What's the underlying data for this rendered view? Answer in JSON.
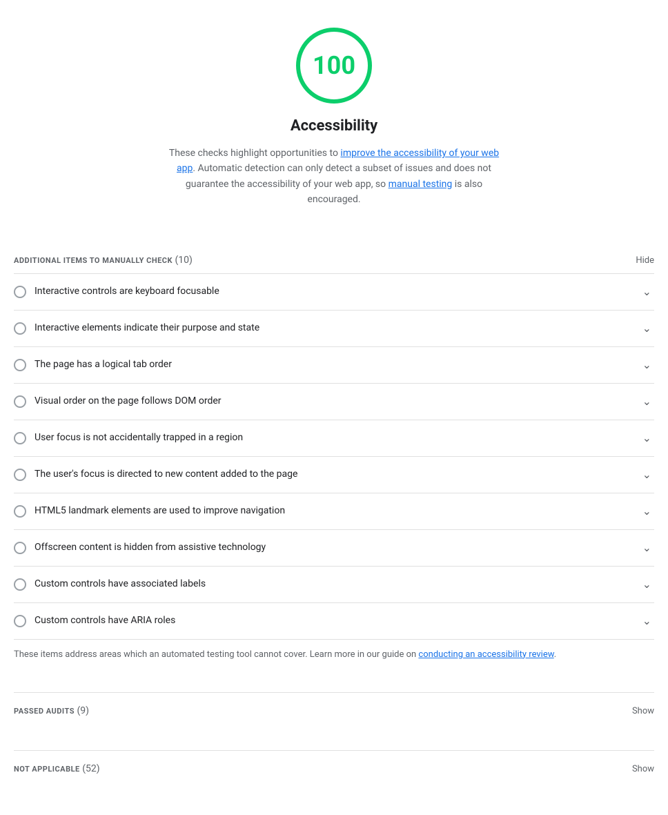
{
  "score": {
    "value": "100",
    "color": "#0cce6b",
    "title": "Accessibility"
  },
  "description": {
    "prefix": "These checks highlight opportunities to ",
    "link1_text": "improve the accessibility of your web app",
    "link1_href": "#",
    "middle": ". Automatic detection can only detect a subset of issues and does not guarantee the accessibility of your web app, so ",
    "link2_text": "manual testing",
    "link2_href": "#",
    "suffix": " is also encouraged."
  },
  "manual_section": {
    "title": "ADDITIONAL ITEMS TO MANUALLY CHECK",
    "count": "(10)",
    "toggle_label": "Hide"
  },
  "audit_items": [
    {
      "label": "Interactive controls are keyboard focusable"
    },
    {
      "label": "Interactive elements indicate their purpose and state"
    },
    {
      "label": "The page has a logical tab order"
    },
    {
      "label": "Visual order on the page follows DOM order"
    },
    {
      "label": "User focus is not accidentally trapped in a region"
    },
    {
      "label": "The user's focus is directed to new content added to the page"
    },
    {
      "label": "HTML5 landmark elements are used to improve navigation"
    },
    {
      "label": "Offscreen content is hidden from assistive technology"
    },
    {
      "label": "Custom controls have associated labels"
    },
    {
      "label": "Custom controls have ARIA roles"
    }
  ],
  "manual_note": {
    "prefix": "These items address areas which an automated testing tool cannot cover. Learn more in our guide on ",
    "link_text": "conducting an accessibility review",
    "link_href": "#",
    "suffix": "."
  },
  "passed_section": {
    "title": "PASSED AUDITS",
    "count": "(9)",
    "toggle_label": "Show"
  },
  "not_applicable_section": {
    "title": "NOT APPLICABLE",
    "count": "(52)",
    "toggle_label": "Show"
  }
}
